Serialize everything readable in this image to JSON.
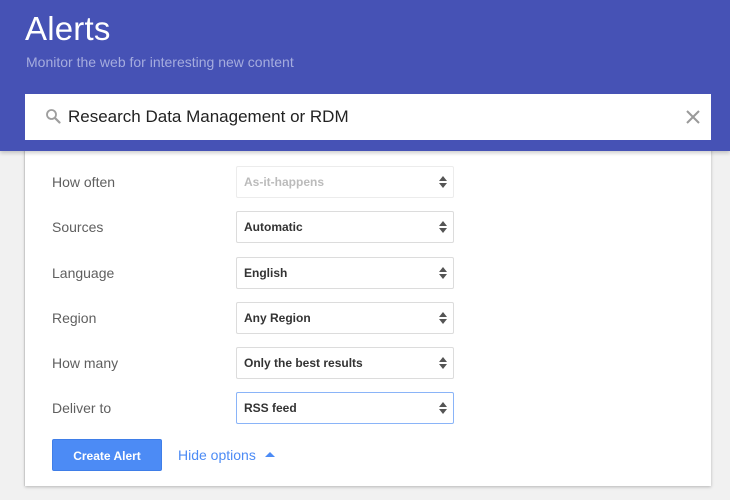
{
  "header": {
    "title": "Alerts",
    "subtitle": "Monitor the web for interesting new content",
    "background_color": "#4652b5"
  },
  "search": {
    "query": "Research Data Management or RDM",
    "search_icon": "search-icon",
    "clear_icon": "close-icon"
  },
  "options": [
    {
      "label": "How often",
      "value": "As-it-happens",
      "state": "disabled"
    },
    {
      "label": "Sources",
      "value": "Automatic",
      "state": "normal"
    },
    {
      "label": "Language",
      "value": "English",
      "state": "normal"
    },
    {
      "label": "Region",
      "value": "Any Region",
      "state": "normal"
    },
    {
      "label": "How many",
      "value": "Only the best results",
      "state": "normal"
    },
    {
      "label": "Deliver to",
      "value": "RSS feed",
      "state": "focused"
    }
  ],
  "actions": {
    "create_label": "Create Alert",
    "hide_options_label": "Hide options",
    "accent_color": "#4c8bf5"
  }
}
